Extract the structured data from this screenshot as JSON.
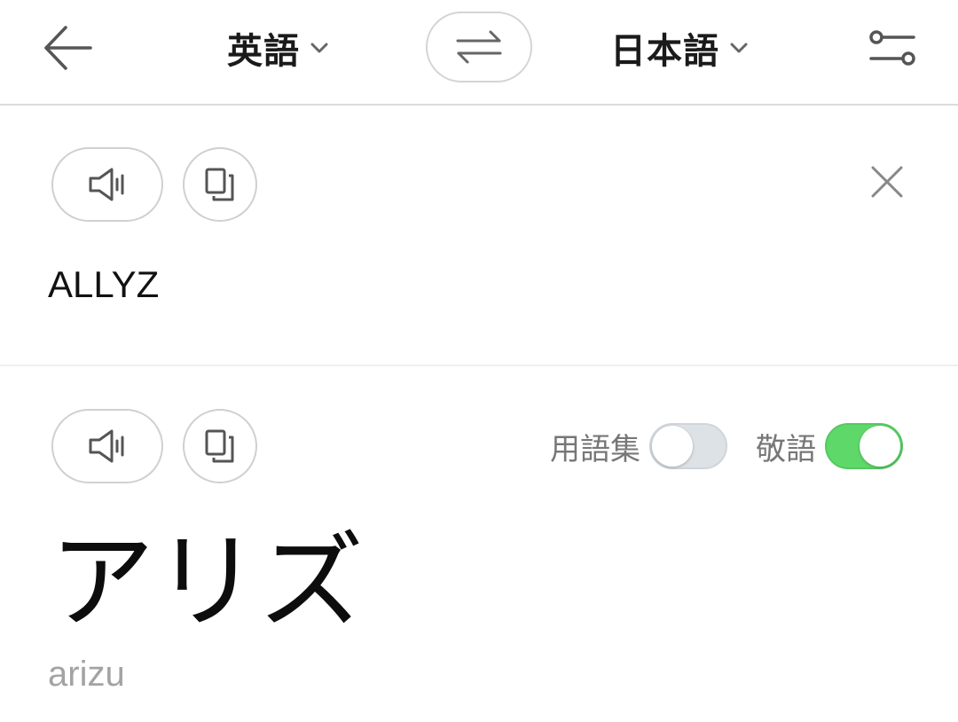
{
  "header": {
    "back_icon": "back-arrow-icon",
    "source_language": "英語",
    "target_language": "日本語",
    "swap_icon": "swap-arrows-icon",
    "settings_icon": "sliders-icon"
  },
  "source": {
    "speak_icon": "speaker-icon",
    "copy_icon": "copy-icon",
    "clear_icon": "close-icon",
    "text": "ALLYZ"
  },
  "target": {
    "speak_icon": "speaker-icon",
    "copy_icon": "copy-icon",
    "glossary_label": "用語集",
    "glossary_enabled": false,
    "honorific_label": "敬語",
    "honorific_enabled": true,
    "text": "アリズ",
    "romanization": "arizu"
  },
  "colors": {
    "toggle_on": "#5fd86a",
    "toggle_off": "#dde2e6",
    "icon_gray": "#555555",
    "romanization_gray": "#a3a3a3"
  }
}
